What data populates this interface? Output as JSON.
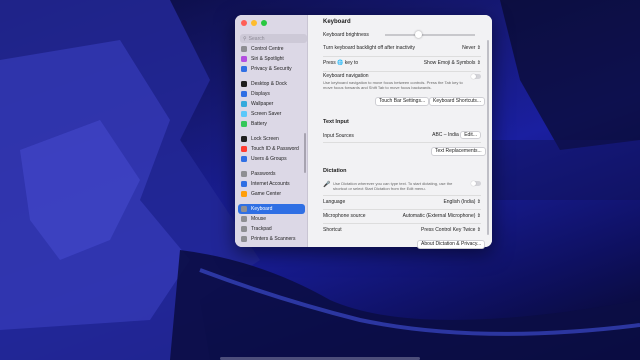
{
  "sidebar": {
    "search_placeholder": "Search",
    "items": [
      {
        "label": "Control Centre",
        "color": "#8e8e93"
      },
      {
        "label": "Siri & Spotlight",
        "color": "#b34de0"
      },
      {
        "label": "Privacy & Security",
        "color": "#2f6fe4"
      },
      {
        "label": "Desktop & Dock",
        "color": "#1e1e1e"
      },
      {
        "label": "Displays",
        "color": "#2f6fe4"
      },
      {
        "label": "Wallpaper",
        "color": "#34aadc"
      },
      {
        "label": "Screen Saver",
        "color": "#5ac8fa"
      },
      {
        "label": "Battery",
        "color": "#34c759"
      },
      {
        "label": "Lock Screen",
        "color": "#1e1e1e"
      },
      {
        "label": "Touch ID & Password",
        "color": "#ff3b30"
      },
      {
        "label": "Users & Groups",
        "color": "#2f6fe4"
      },
      {
        "label": "Passwords",
        "color": "#8e8e93"
      },
      {
        "label": "Internet Accounts",
        "color": "#2f6fe4"
      },
      {
        "label": "Game Center",
        "color": "#ff9f0a"
      },
      {
        "label": "Keyboard",
        "color": "#8e8e93"
      },
      {
        "label": "Mouse",
        "color": "#8e8e93"
      },
      {
        "label": "Trackpad",
        "color": "#8e8e93"
      },
      {
        "label": "Printers & Scanners",
        "color": "#8e8e93"
      }
    ],
    "selected": "Keyboard"
  },
  "content": {
    "title": "Keyboard",
    "brightness_label": "Keyboard brightness",
    "backlight_off": {
      "label": "Turn keyboard backlight off after inactivity",
      "value": "Never"
    },
    "press_key": {
      "label_pre": "Press",
      "label_post": "key to",
      "value": "Show Emoji & Symbols"
    },
    "keyboard_navigation": {
      "label": "Keyboard navigation",
      "description": "Use keyboard navigation to move focus between controls. Press the Tab key to move focus forwards and Shift Tab to move focus backwards."
    },
    "touch_bar_button": "Touch Bar Settings...",
    "shortcuts_button": "Keyboard Shortcuts...",
    "text_input_heading": "Text Input",
    "input_sources": {
      "label": "Input Sources",
      "value": "ABC – India",
      "edit": "Edit..."
    },
    "text_replacements_button": "Text Replacements...",
    "dictation_heading": "Dictation",
    "dictation_description": "Use Dictation wherever you can type text. To start dictating, use the shortcut or select Start Dictation from the Edit menu.",
    "language": {
      "label": "Language",
      "value": "English (India)"
    },
    "microphone": {
      "label": "Microphone source",
      "value": "Automatic (External Microphone)"
    },
    "shortcut": {
      "label": "Shortcut",
      "value": "Press Control Key Twice"
    },
    "about_dictation_button": "About Dictation & Privacy..."
  }
}
